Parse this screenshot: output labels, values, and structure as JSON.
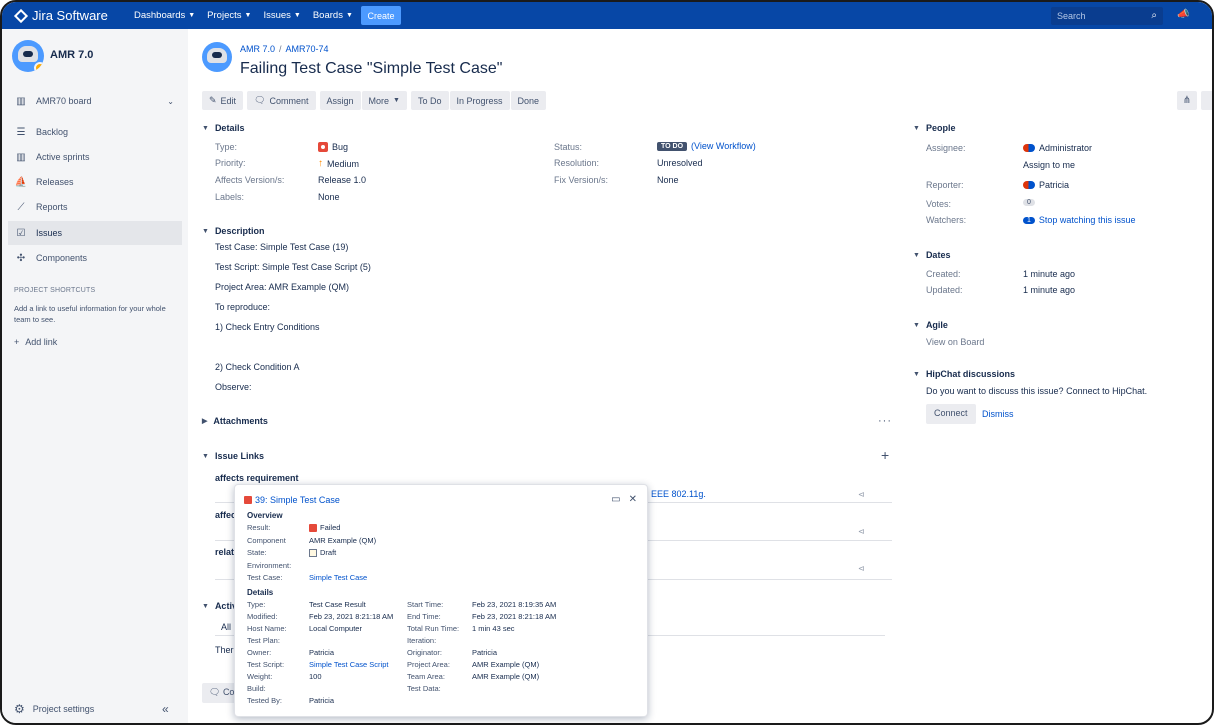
{
  "topnav": {
    "brand": "Jira Software",
    "menu": [
      "Dashboards",
      "Projects",
      "Issues",
      "Boards"
    ],
    "create": "Create",
    "search_placeholder": "Search",
    "accent": "#0747a6"
  },
  "sidebar": {
    "project_name": "AMR 7.0",
    "board": "AMR70 board",
    "items": [
      {
        "label": "Backlog",
        "icon": "backlog-icon"
      },
      {
        "label": "Active sprints",
        "icon": "board-icon"
      },
      {
        "label": "Releases",
        "icon": "ship-icon"
      },
      {
        "label": "Reports",
        "icon": "chart-icon"
      },
      {
        "label": "Issues",
        "icon": "issues-icon",
        "active": true
      },
      {
        "label": "Components",
        "icon": "puzzle-icon"
      }
    ],
    "shortcuts_title": "PROJECT SHORTCUTS",
    "shortcuts_text": "Add a link to useful information for your whole team to see.",
    "add_link": "Add link",
    "project_settings": "Project settings"
  },
  "issue": {
    "breadcrumb_project": "AMR 7.0",
    "breadcrumb_key": "AMR70-74",
    "title": "Failing Test Case \"Simple Test Case\"",
    "toolbar": {
      "edit": "Edit",
      "comment": "Comment",
      "assign": "Assign",
      "more": "More",
      "todo": "To Do",
      "in_progress": "In Progress",
      "done": "Done"
    }
  },
  "details": {
    "heading": "Details",
    "type_label": "Type:",
    "type_value": "Bug",
    "priority_label": "Priority:",
    "priority_value": "Medium",
    "affects_label": "Affects Version/s:",
    "affects_value": "Release 1.0",
    "labels_label": "Labels:",
    "labels_value": "None",
    "status_label": "Status:",
    "status_badge": "TO DO",
    "status_link": "(View Workflow)",
    "resolution_label": "Resolution:",
    "resolution_value": "Unresolved",
    "fix_label": "Fix Version/s:",
    "fix_value": "None"
  },
  "description": {
    "heading": "Description",
    "lines": [
      "Test Case: Simple Test Case (19)",
      "Test Script: Simple Test Case Script (5)",
      "Project Area: AMR Example (QM)",
      "To reproduce:",
      "1) Check Entry Conditions",
      "2) Check Condition A",
      "Observe:"
    ]
  },
  "attachments": {
    "heading": "Attachments"
  },
  "issue_links": {
    "heading": "Issue Links",
    "group1": "affects requirement",
    "group2_partial": "affec",
    "group3_partial": "relat",
    "row1_text_partial": "EEE 802.11g."
  },
  "activity": {
    "heading_partial": "Activ",
    "tab_partial": "All",
    "text_partial": "Ther",
    "comment_partial": "Co"
  },
  "people": {
    "heading": "People",
    "assignee_label": "Assignee:",
    "assignee_value": "Administrator",
    "assign_to_me": "Assign to me",
    "reporter_label": "Reporter:",
    "reporter_value": "Patricia",
    "votes_label": "Votes:",
    "votes_value": "0",
    "watchers_label": "Watchers:",
    "watchers_count": "1",
    "stop_watching": "Stop watching this issue"
  },
  "dates": {
    "heading": "Dates",
    "created_label": "Created:",
    "created_value": "1 minute ago",
    "updated_label": "Updated:",
    "updated_value": "1 minute ago"
  },
  "agile": {
    "heading": "Agile",
    "link": "View on Board"
  },
  "hipchat": {
    "heading": "HipChat discussions",
    "text": "Do you want to discuss this issue? Connect to HipChat.",
    "connect": "Connect",
    "dismiss": "Dismiss"
  },
  "popup": {
    "title": "39: Simple Test Case",
    "overview": "Overview",
    "result_label": "Result:",
    "result_value": "Failed",
    "component_label": "Component",
    "component_value": "AMR Example (QM)",
    "state_label": "State:",
    "state_value": "Draft",
    "environment_label": "Environment:",
    "testcase_label": "Test Case:",
    "testcase_value": "Simple Test Case",
    "details": "Details",
    "left": [
      {
        "label": "Type:",
        "value": "Test Case Result"
      },
      {
        "label": "Modified:",
        "value": "Feb 23, 2021 8:21:18 AM"
      },
      {
        "label": "Host Name:",
        "value": "Local Computer"
      },
      {
        "label": "Test Plan:",
        "value": ""
      },
      {
        "label": "Owner:",
        "value": "Patricia"
      },
      {
        "label": "Test Script:",
        "value": "Simple Test Case Script"
      },
      {
        "label": "Weight:",
        "value": "100"
      },
      {
        "label": "Build:",
        "value": ""
      },
      {
        "label": "Tested By:",
        "value": "Patricia"
      }
    ],
    "right": [
      {
        "label": "Start Time:",
        "value": "Feb 23, 2021 8:19:35 AM"
      },
      {
        "label": "End Time:",
        "value": "Feb 23, 2021 8:21:18 AM"
      },
      {
        "label": "Total Run Time:",
        "value": "1 min 43 sec"
      },
      {
        "label": "Iteration:",
        "value": ""
      },
      {
        "label": "Originator:",
        "value": "Patricia"
      },
      {
        "label": "Project Area:",
        "value": "AMR Example (QM)"
      },
      {
        "label": "Team Area:",
        "value": "AMR Example (QM)"
      },
      {
        "label": "Test Data:",
        "value": ""
      }
    ]
  }
}
